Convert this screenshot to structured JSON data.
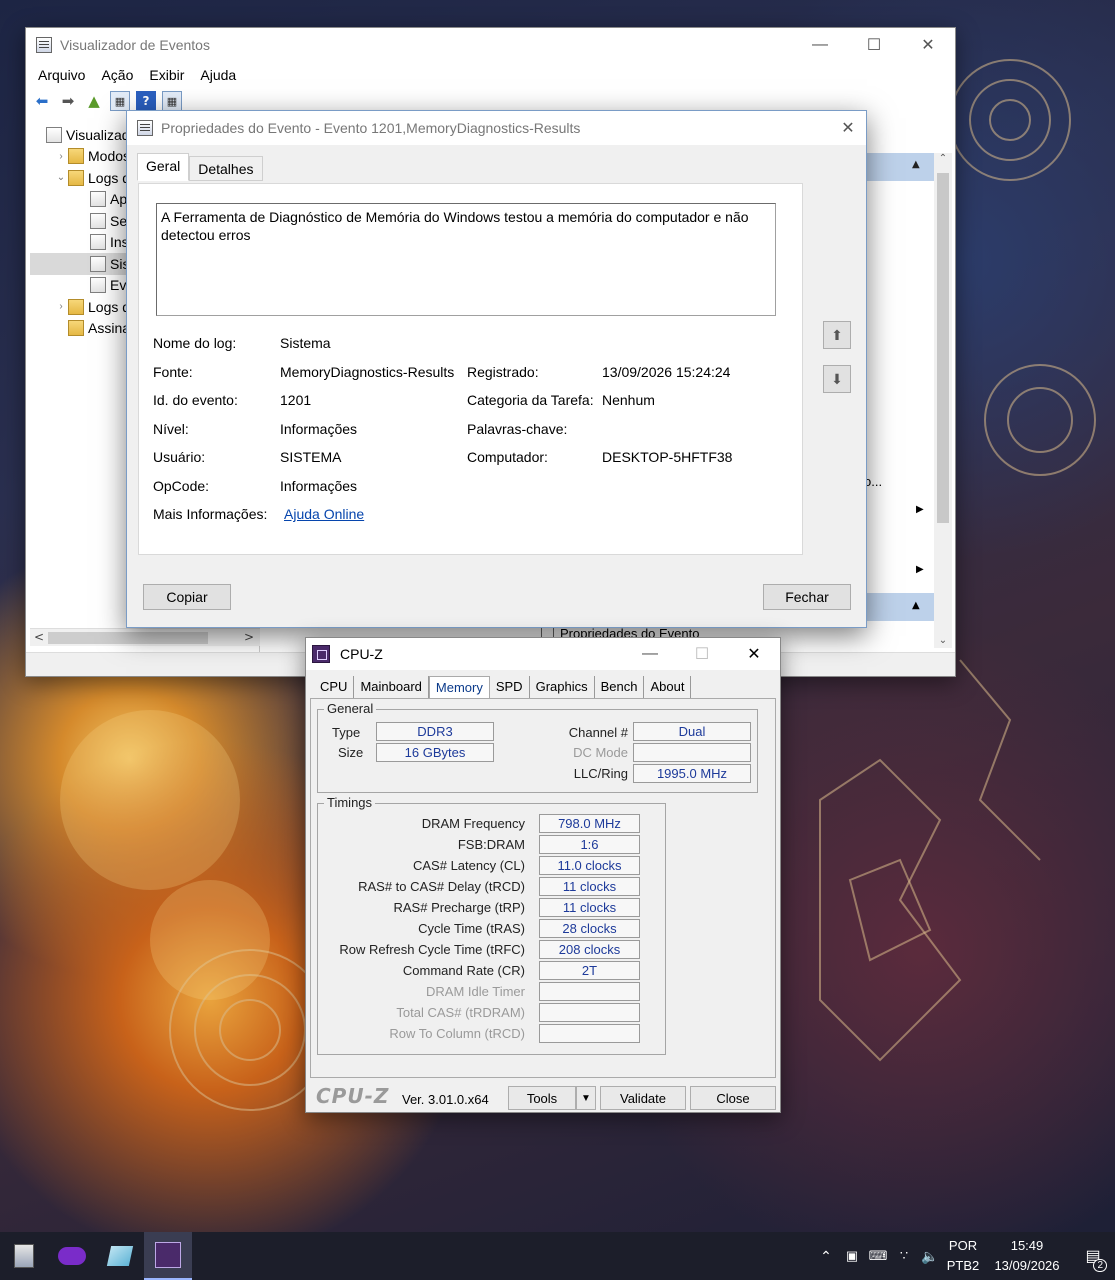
{
  "event_viewer": {
    "title": "Visualizador de Eventos",
    "menu": [
      "Arquivo",
      "Ação",
      "Exibir",
      "Ajuda"
    ],
    "tree": [
      {
        "label": "Visualizado",
        "indent": 0,
        "expander": "",
        "folder": false,
        "selected": false
      },
      {
        "label": "Modos",
        "indent": 1,
        "expander": ">",
        "folder": true,
        "selected": false
      },
      {
        "label": "Logs do",
        "indent": 1,
        "expander": "v",
        "folder": true,
        "selected": false
      },
      {
        "label": "Apli",
        "indent": 2,
        "expander": "",
        "folder": false,
        "selected": false
      },
      {
        "label": "Segu",
        "indent": 2,
        "expander": "",
        "folder": false,
        "selected": false
      },
      {
        "label": "Insta",
        "indent": 2,
        "expander": "",
        "folder": false,
        "selected": false
      },
      {
        "label": "Siste",
        "indent": 2,
        "expander": "",
        "folder": false,
        "selected": true
      },
      {
        "label": "Ever",
        "indent": 2,
        "expander": "",
        "folder": false,
        "selected": false
      },
      {
        "label": "Logs de",
        "indent": 1,
        "expander": ">",
        "folder": true,
        "selected": false
      },
      {
        "label": "Assinatu",
        "indent": 1,
        "expander": "",
        "folder": true,
        "selected": false
      }
    ],
    "action_pane_partial": "o...",
    "bottom_action": "Propriedades do Evento"
  },
  "event_dialog": {
    "title": "Propriedades do Evento - Evento 1201,MemoryDiagnostics-Results",
    "tabs": [
      "Geral",
      "Detalhes"
    ],
    "description": "A Ferramenta de Diagnóstico de Memória do Windows testou a memória do computador e não detectou erros",
    "labels": {
      "log_name": "Nome do log:",
      "source": "Fonte:",
      "event_id": "Id. do evento:",
      "level": "Nível:",
      "user": "Usuário:",
      "opcode": "OpCode:",
      "more_info": "Mais Informações:",
      "logged": "Registrado:",
      "task_category": "Categoria da Tarefa:",
      "keywords": "Palavras-chave:",
      "computer": "Computador:"
    },
    "values": {
      "log_name": "Sistema",
      "source": "MemoryDiagnostics-Results",
      "event_id": "1201",
      "level": "Informações",
      "user": "SISTEMA",
      "opcode": "Informações",
      "more_info_link": "Ajuda Online",
      "logged": "13/09/2026 15:24:24",
      "task_category": "Nenhum",
      "keywords": "",
      "computer": "DESKTOP-5HFTF38"
    },
    "copy_button": "Copiar",
    "close_button": "Fechar"
  },
  "cpuz": {
    "title": "CPU-Z",
    "tabs": [
      "CPU",
      "Mainboard",
      "Memory",
      "SPD",
      "Graphics",
      "Bench",
      "About"
    ],
    "active_tab": "Memory",
    "general": {
      "title": "General",
      "type_label": "Type",
      "type": "DDR3",
      "size_label": "Size",
      "size": "16 GBytes",
      "channel_label": "Channel #",
      "channel": "Dual",
      "dc_mode_label": "DC Mode",
      "dc_mode": "",
      "llc_label": "LLC/Ring",
      "llc": "1995.0 MHz"
    },
    "timings": {
      "title": "Timings",
      "rows": [
        {
          "label": "DRAM Frequency",
          "value": "798.0 MHz",
          "dim": false
        },
        {
          "label": "FSB:DRAM",
          "value": "1:6",
          "dim": false
        },
        {
          "label": "CAS# Latency (CL)",
          "value": "11.0 clocks",
          "dim": false
        },
        {
          "label": "RAS# to CAS# Delay (tRCD)",
          "value": "11 clocks",
          "dim": false
        },
        {
          "label": "RAS# Precharge (tRP)",
          "value": "11 clocks",
          "dim": false
        },
        {
          "label": "Cycle Time (tRAS)",
          "value": "28 clocks",
          "dim": false
        },
        {
          "label": "Row Refresh Cycle Time (tRFC)",
          "value": "208 clocks",
          "dim": false
        },
        {
          "label": "Command Rate (CR)",
          "value": "2T",
          "dim": false
        },
        {
          "label": "DRAM Idle Timer",
          "value": "",
          "dim": true
        },
        {
          "label": "Total CAS# (tRDRAM)",
          "value": "",
          "dim": true
        },
        {
          "label": "Row To Column (tRCD)",
          "value": "",
          "dim": true
        }
      ]
    },
    "footer": {
      "logo": "CPU-Z",
      "version": "Ver. 3.01.0.x64",
      "tools": "Tools",
      "validate": "Validate",
      "close": "Close"
    }
  },
  "taskbar": {
    "language": "POR",
    "layout": "PTB2",
    "time": "15:49",
    "date": "13/09/2026",
    "notification_count": "2"
  }
}
